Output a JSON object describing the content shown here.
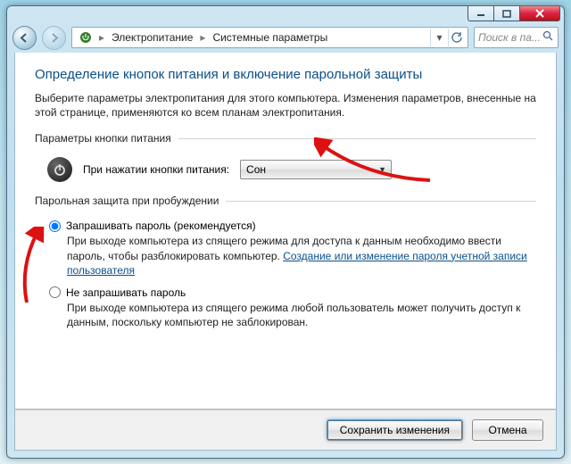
{
  "breadcrumb": {
    "item1": "Электропитание",
    "item2": "Системные параметры"
  },
  "search": {
    "placeholder": "Поиск в па..."
  },
  "page": {
    "heading": "Определение кнопок питания и включение парольной защиты",
    "description": "Выберите параметры электропитания для этого компьютера. Изменения параметров, внесенные на этой странице, применяются ко всем планам электропитания."
  },
  "groups": {
    "power_button": {
      "legend": "Параметры кнопки питания",
      "label": "При нажатии кнопки питания:",
      "selected": "Сон"
    },
    "password": {
      "legend": "Парольная защита при пробуждении",
      "opt_require_label": "Запрашивать пароль (рекомендуется)",
      "opt_require_desc_pre": "При выходе компьютера из спящего режима для доступа к данным необходимо ввести пароль, чтобы разблокировать компьютер. ",
      "opt_require_link": "Создание или изменение пароля учетной записи пользователя",
      "opt_norequire_label": "Не запрашивать пароль",
      "opt_norequire_desc": "При выходе компьютера из спящего режима любой пользователь может получить доступ к данным, поскольку компьютер не заблокирован."
    }
  },
  "footer": {
    "save": "Сохранить изменения",
    "cancel": "Отмена"
  }
}
